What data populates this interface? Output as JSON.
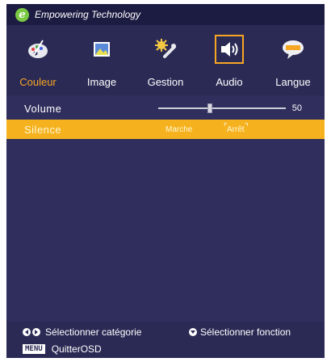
{
  "header": {
    "logo_letter": "e",
    "brand": "Empowering Technology"
  },
  "tabs": [
    {
      "label": "Couleur",
      "icon": "palette-icon",
      "state": "active-label"
    },
    {
      "label": "Image",
      "icon": "image-icon",
      "state": "normal"
    },
    {
      "label": "Gestion",
      "icon": "management-icon",
      "state": "normal"
    },
    {
      "label": "Audio",
      "icon": "speaker-icon",
      "state": "selected"
    },
    {
      "label": "Langue",
      "icon": "language-icon",
      "state": "normal"
    }
  ],
  "rows": {
    "volume": {
      "label": "Volume",
      "value": "50",
      "level": 0.5
    },
    "silence": {
      "label": "Silence",
      "option_on": "Marche",
      "option_off": "Arrêt",
      "selected": "Arrêt"
    }
  },
  "footer": {
    "select_category": "Sélectionner catégorie",
    "select_function": "Sélectionner fonction",
    "menu_key": "MENU",
    "quit": "QuitterOSD"
  },
  "colors": {
    "accent": "#f5b21e",
    "panel": "#2b2a55",
    "brand_green": "#7ac943"
  }
}
